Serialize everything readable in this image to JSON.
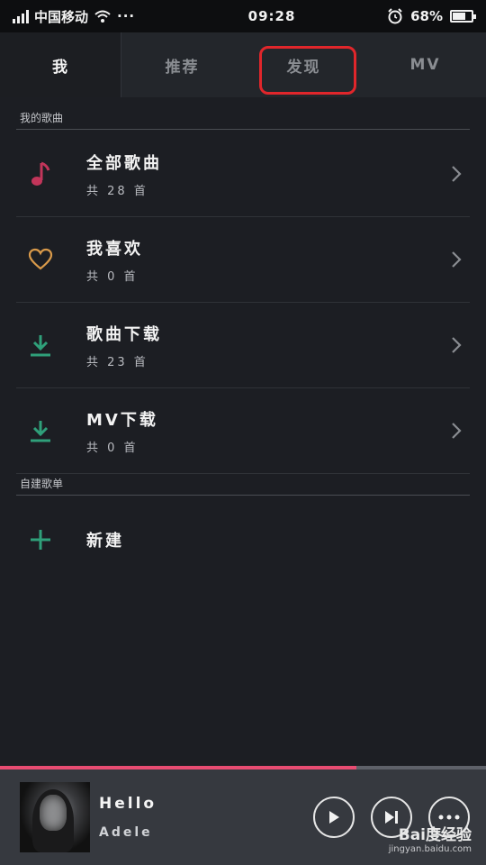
{
  "status_bar": {
    "carrier": "中国移动",
    "time": "09:28",
    "battery": "68%",
    "battery_level": 0.68,
    "more": "···"
  },
  "tabs": [
    {
      "label": "我"
    },
    {
      "label": "推荐"
    },
    {
      "label": "发现"
    },
    {
      "label": "MV"
    }
  ],
  "my_songs": {
    "header": "我的歌曲",
    "items": [
      {
        "title": "全部歌曲",
        "subtitle": "共 28 首",
        "icon": "music-note-icon",
        "color": "#c2355a"
      },
      {
        "title": "我喜欢",
        "subtitle": "共 0 首",
        "icon": "heart-icon",
        "color": "#d99a4a"
      },
      {
        "title": "歌曲下载",
        "subtitle": "共 23 首",
        "icon": "download-icon",
        "color": "#2fa07a"
      },
      {
        "title": "MV下载",
        "subtitle": "共 0 首",
        "icon": "download-icon",
        "color": "#2fa07a"
      }
    ]
  },
  "playlists": {
    "header": "自建歌单",
    "new_label": "新建"
  },
  "player": {
    "title": "Hello",
    "artist": "Adele",
    "progress": 0.733
  },
  "watermark": {
    "brand": "Bai度经验",
    "url": "jingyan.baidu.com"
  },
  "colors": {
    "background": "#1c1e23",
    "highlight": "#e0262b",
    "progress": "#e84c72"
  }
}
